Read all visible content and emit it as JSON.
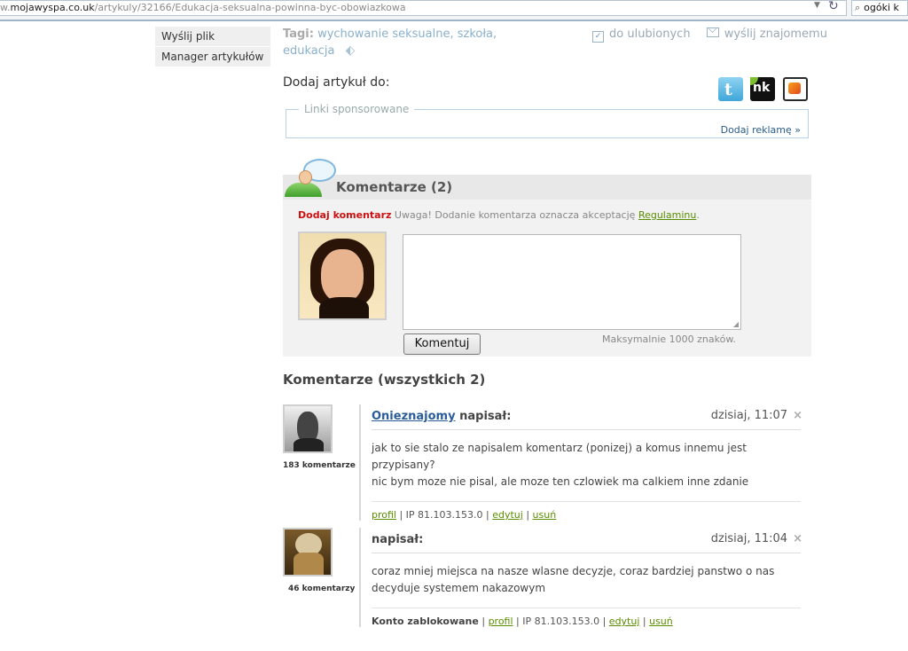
{
  "browser": {
    "url_prefix": "w.",
    "url_domain": "mojawyspa.co.uk",
    "url_path": "/artykuly/32166/Edukacja-seksualna-powinna-byc-obowiazkowa",
    "search_value": "ogóki k"
  },
  "sidebar": {
    "items": [
      {
        "label": "Wyślij plik"
      },
      {
        "label": "Manager artykułów"
      }
    ]
  },
  "tags": {
    "label": "Tagi:",
    "items": [
      "wychowanie seksualne,",
      "szkoła,",
      "edukacja"
    ]
  },
  "actions": {
    "favorites": "do ulubionych",
    "send_friend": "wyślij znajomemu"
  },
  "share": {
    "label": "Dodaj artykuł do:",
    "twitter_glyph": "t",
    "nk_glyph": "nk"
  },
  "sponsored": {
    "legend": "Linki sponsorowane",
    "add_ad": "Dodaj reklamę »"
  },
  "comments_section": {
    "title": "Komentarze (2)",
    "add_label": "Dodaj komentarz",
    "notice": " Uwaga! Dodanie komentarza oznacza akceptację ",
    "rules_link": "Regulaminu",
    "notice_end": ".",
    "textarea_value": "",
    "submit": "Komentuj",
    "max_chars": "Maksymalnie 1000 znaków."
  },
  "all_comments_title": "Komentarze (wszystkich 2)",
  "comments": [
    {
      "author": "Onieznajomy",
      "wrote": " napisał:",
      "date": "dzisiaj, 11:07",
      "close": "×",
      "count": "183 komentarze",
      "line1": "jak to sie stalo ze napisalem komentarz (ponizej) a komus innemu jest przypisany?",
      "line2": "nic bym moze nie pisal, ale moze ten czlowiek ma calkiem inne zdanie",
      "profile": "profil",
      "ip": " | IP 81.103.153.0 | ",
      "edit": "edytuj",
      "sep": " | ",
      "delete": "usuń"
    },
    {
      "author": "",
      "wrote": "napisał:",
      "date": "dzisiaj, 11:04",
      "close": "×",
      "count": "46 komentarzy",
      "line1": "coraz mniej miejsca na nasze wlasne decyzje, coraz bardziej panstwo o nas",
      "line2": "decyduje systemem nakazowym",
      "blocked": "Konto zablokowane",
      "blocked_sep": " | ",
      "profile": "profil",
      "ip": " | IP 81.103.153.0 | ",
      "edit": "edytuj",
      "sep": " | ",
      "delete": "usuń"
    }
  ],
  "colors": {
    "accent_red": "#cc1111",
    "link_green": "#5a8c00",
    "link_blue": "#2a5c9a"
  }
}
